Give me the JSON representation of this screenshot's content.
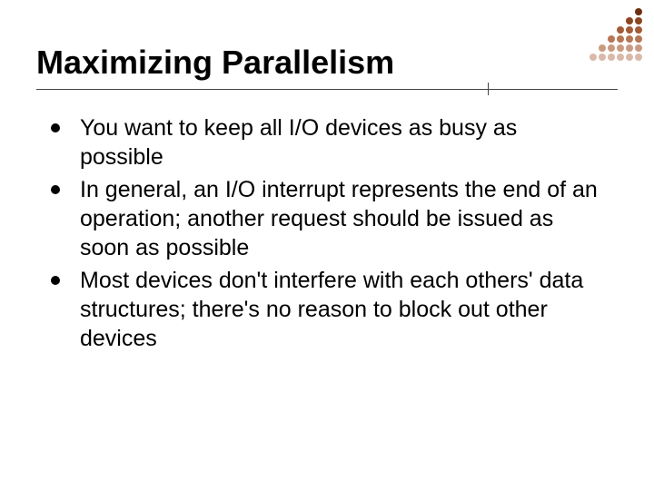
{
  "title": "Maximizing Parallelism",
  "bullets": [
    "You want to keep all I/O devices as busy as possible",
    "In general, an I/O interrupt represents the end of an operation; another request should be issued as soon as possible",
    "Most devices don't interfere with each others' data structures; there's no reason to block out other devices"
  ],
  "decor": {
    "dot_colors_light_to_dark": [
      "#d9b9a8",
      "#c99a82",
      "#b67654",
      "#a25b37",
      "#8a4520",
      "#6e2f10"
    ]
  }
}
